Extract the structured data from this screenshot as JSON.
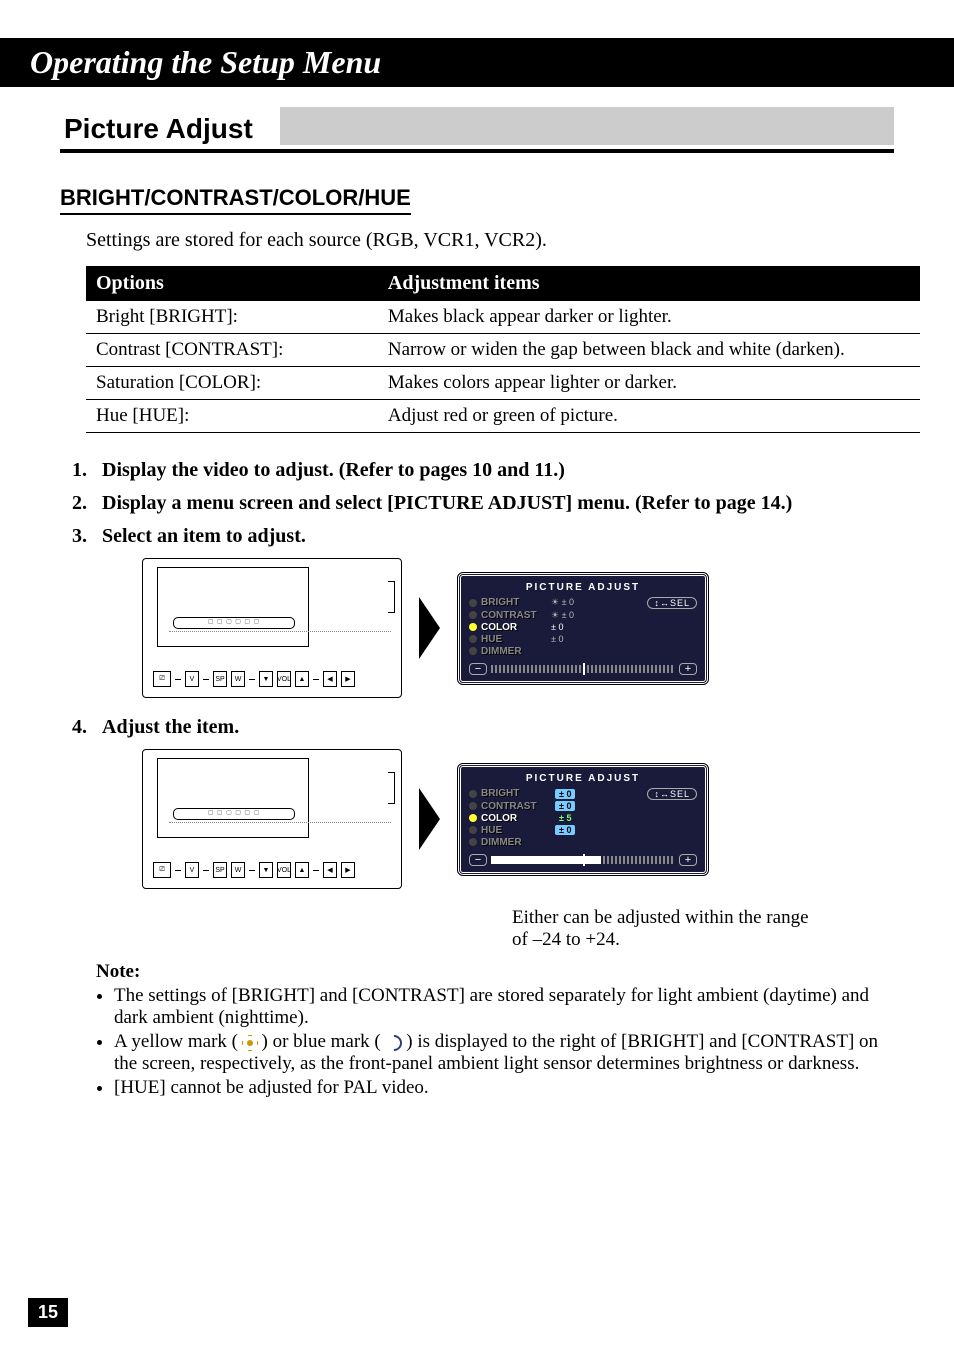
{
  "chapter_title": "Operating the Setup Menu",
  "section_title": "Picture Adjust",
  "subsection_title": "BRIGHT/CONTRAST/COLOR/HUE",
  "intro_text": "Settings are stored for each source (RGB, VCR1, VCR2).",
  "table": {
    "headers": {
      "col1": "Options",
      "col2": "Adjustment items"
    },
    "rows": [
      {
        "option": "Bright [BRIGHT]:",
        "item": "Makes black appear darker or lighter."
      },
      {
        "option": "Contrast [CONTRAST]:",
        "item": "Narrow or widen the gap between black and white (darken)."
      },
      {
        "option": "Saturation [COLOR]:",
        "item": "Makes colors appear lighter or darker."
      },
      {
        "option": "Hue [HUE]:",
        "item": "Adjust red or green of picture."
      }
    ]
  },
  "steps": [
    "Display the video to adjust. (Refer to pages 10 and 11.)",
    "Display a menu screen and select [PICTURE ADJUST] menu. (Refer to page 14.)",
    "Select an item to adjust.",
    "Adjust the item."
  ],
  "osd": {
    "title": "PICTURE ADJUST",
    "sel_label": "SEL",
    "items": [
      {
        "label": "BRIGHT",
        "sym": "☀ ± 0"
      },
      {
        "label": "CONTRAST",
        "sym": "☀ ± 0"
      },
      {
        "label": "COLOR",
        "sym": "± 0",
        "active": true
      },
      {
        "label": "HUE",
        "sym": "± 0"
      },
      {
        "label": "DIMMER",
        "sym": ""
      }
    ],
    "bar_minus": "−",
    "bar_plus": "+"
  },
  "osd2": {
    "title": "PICTURE ADJUST",
    "sel_label": "SEL",
    "items": [
      {
        "label": "BRIGHT",
        "sym": "± 0"
      },
      {
        "label": "CONTRAST",
        "sym": "± 0"
      },
      {
        "label": "COLOR",
        "sym": "± 5",
        "active": true
      },
      {
        "label": "HUE",
        "sym": "± 0"
      },
      {
        "label": "DIMMER",
        "sym": ""
      }
    ],
    "bar_minus": "−",
    "bar_plus": "+"
  },
  "caption_line1": "Either can be adjusted within the range",
  "caption_line2": "of –24 to +24.",
  "notes_title": "Note:",
  "notes": [
    "The settings of [BRIGHT] and [CONTRAST] are stored separately for light ambient (daytime) and dark ambient (nighttime).",
    "A yellow mark (   ) or blue mark (   ) is displayed to the right of [BRIGHT] and [CONTRAST] on the screen, respectively, as the front-panel ambient light sensor determines brightness or darkness.",
    "[HUE] cannot be adjusted for PAL video."
  ],
  "panel_buttons": [
    "⎚",
    "V",
    "SP",
    "W",
    "▼",
    "VOL",
    "▲",
    "◀",
    "▶"
  ],
  "page_number": "15"
}
